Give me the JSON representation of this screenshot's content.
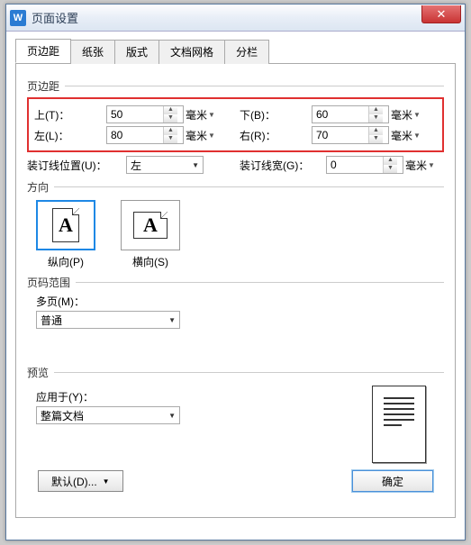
{
  "app_icon_letter": "W",
  "window_title": "页面设置",
  "tabs": [
    "页边距",
    "纸张",
    "版式",
    "文档网格",
    "分栏"
  ],
  "active_tab": 0,
  "margins": {
    "section_label": "页边距",
    "top_label": "上(T)：",
    "top_value": "50",
    "bottom_label": "下(B)：",
    "bottom_value": "60",
    "left_label": "左(L)：",
    "left_value": "80",
    "right_label": "右(R)：",
    "right_value": "70",
    "unit": "毫米"
  },
  "gutter": {
    "pos_label": "装订线位置(U)：",
    "pos_value": "左",
    "width_label": "装订线宽(G)：",
    "width_value": "0",
    "width_unit": "毫米"
  },
  "orientation": {
    "section_label": "方向",
    "portrait_label": "纵向(P)",
    "landscape_label": "横向(S)",
    "selected": "portrait"
  },
  "page_range": {
    "section_label": "页码范围",
    "multi_label": "多页(M)：",
    "multi_value": "普通"
  },
  "preview": {
    "section_label": "预览",
    "apply_label": "应用于(Y)：",
    "apply_value": "整篇文档"
  },
  "buttons": {
    "default": "默认(D)...",
    "ok": "确定"
  }
}
